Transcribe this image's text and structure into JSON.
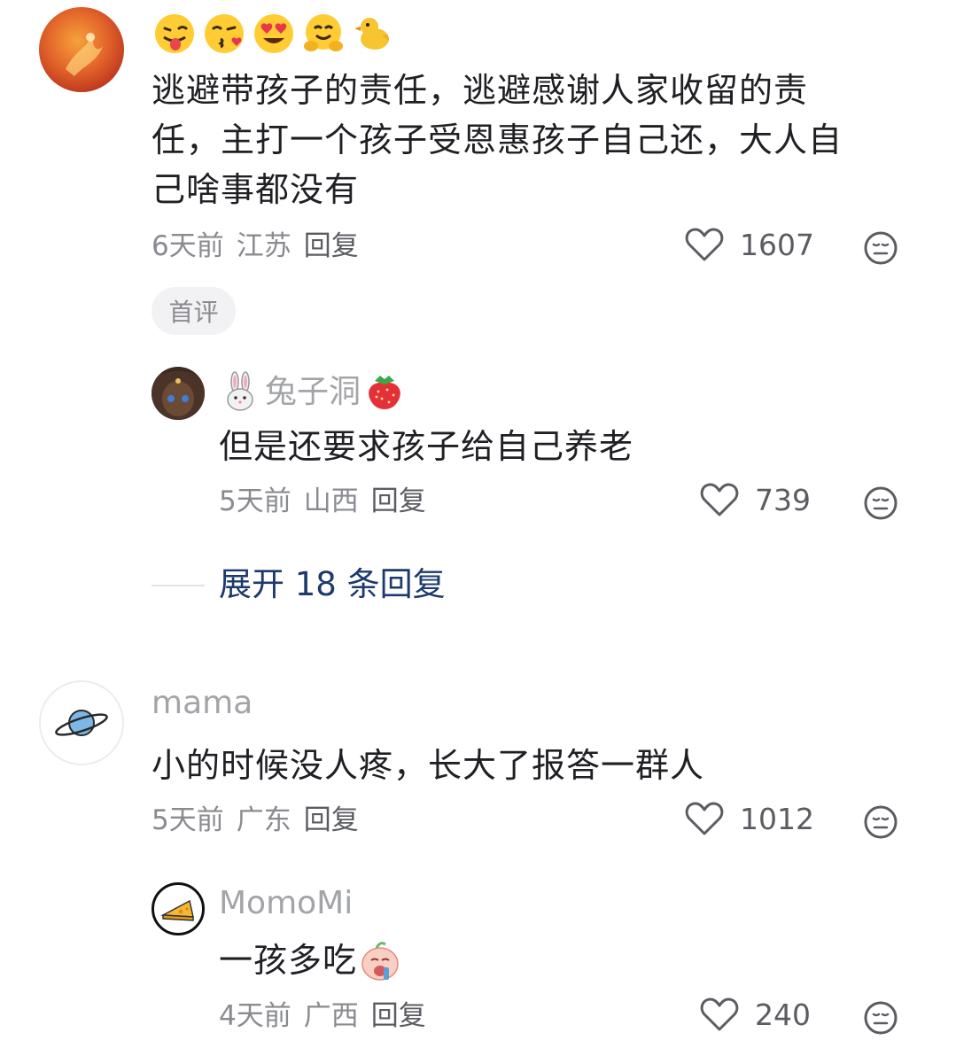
{
  "comments": [
    {
      "emoji_row": [
        "tongue-wink-emoji",
        "kiss-emoji",
        "heart-eyes-emoji",
        "hug-emoji",
        "chick-emoji"
      ],
      "text": "逃避带孩子的责任，逃避感谢人家收留的责\n任，主打一个孩子受恩惠孩子自己还，大人自\n己啥事都没有",
      "time": "6天前",
      "location": "江苏",
      "reply_label": "回复",
      "likes": "1607",
      "badge": "首评",
      "replies": [
        {
          "username": "兔子洞",
          "text": "但是还要求孩子给自己养老",
          "time": "5天前",
          "location": "山西",
          "reply_label": "回复",
          "likes": "739"
        }
      ],
      "expand_label": "展开 18 条回复"
    },
    {
      "username": "mama",
      "text": "小的时候没人疼，长大了报答一群人",
      "time": "5天前",
      "location": "广东",
      "reply_label": "回复",
      "likes": "1012",
      "replies": [
        {
          "username": "MomoMi",
          "text": "一孩多吃",
          "time": "4天前",
          "location": "广西",
          "reply_label": "回复",
          "likes": "240"
        }
      ]
    }
  ]
}
